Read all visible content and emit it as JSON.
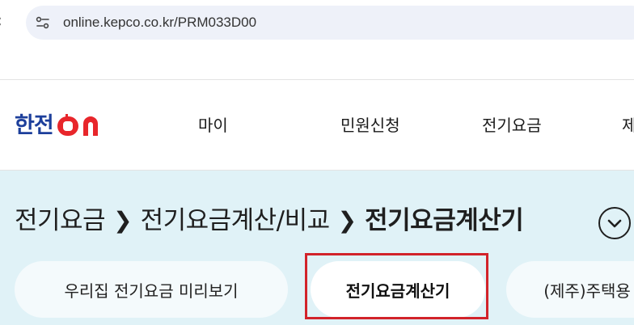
{
  "browser": {
    "url": "online.kepco.co.kr/PRM033D00",
    "back_icon": "back-arrow-icon",
    "site_info_icon": "tune-icon"
  },
  "header": {
    "logo_text": "한전",
    "logo_mark": "ON",
    "nav": [
      "마이",
      "민원신청",
      "전기요금",
      "제"
    ]
  },
  "breadcrumb": {
    "items": [
      "전기요금",
      "전기요금계산/비교",
      "전기요금계산기"
    ],
    "toggle_icon": "chevron-down-icon"
  },
  "tabs": [
    {
      "label": "우리집 전기요금 미리보기",
      "active": false
    },
    {
      "label": "전기요금계산기",
      "active": true
    },
    {
      "label": "(제주)주택용",
      "active": false
    }
  ],
  "colors": {
    "brand": "#1d3f9b",
    "logo_accent": "#e8262b",
    "hero_bg": "#e0f2f7",
    "highlight": "#d2232a"
  }
}
